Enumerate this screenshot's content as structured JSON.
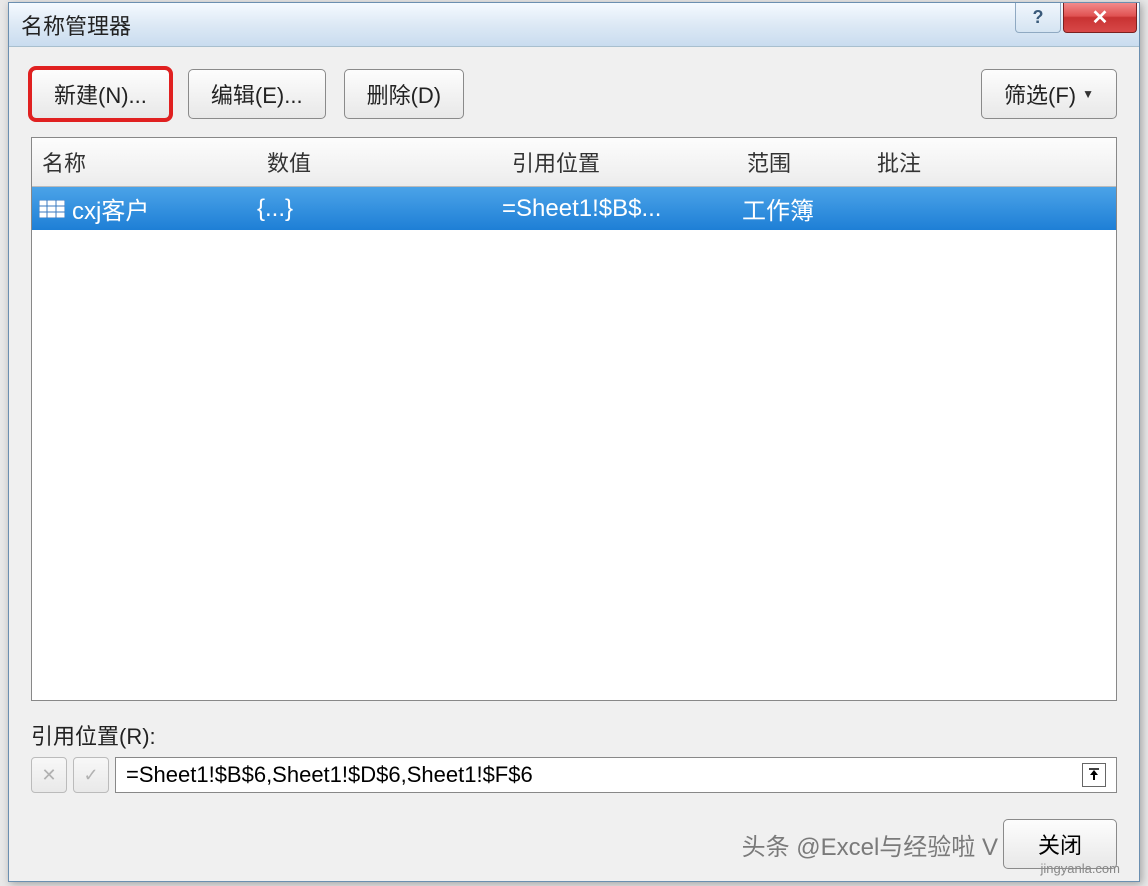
{
  "dialog": {
    "title": "名称管理器",
    "help_symbol": "?",
    "close_symbol": "✕"
  },
  "toolbar": {
    "new_label": "新建(N)...",
    "edit_label": "编辑(E)...",
    "delete_label": "删除(D)",
    "filter_label": "筛选(F)"
  },
  "columns": {
    "name": "名称",
    "value": "数值",
    "refers_to": "引用位置",
    "scope": "范围",
    "comment": "批注"
  },
  "rows": [
    {
      "name": "cxj客户",
      "value": "{...}",
      "refers_to": "=Sheet1!$B$...",
      "scope": "工作簿",
      "comment": ""
    }
  ],
  "refers": {
    "label": "引用位置(R):",
    "value": "=Sheet1!$B$6,Sheet1!$D$6,Sheet1!$F$6"
  },
  "footer": {
    "close_label": "关闭"
  },
  "icons": {
    "cancel_x": "✕",
    "accept_check": "✓",
    "collapse_arrow": "⬆"
  },
  "watermark": {
    "main": "头条 @Excel与经验啦 V",
    "site": "jingyanla.com"
  }
}
